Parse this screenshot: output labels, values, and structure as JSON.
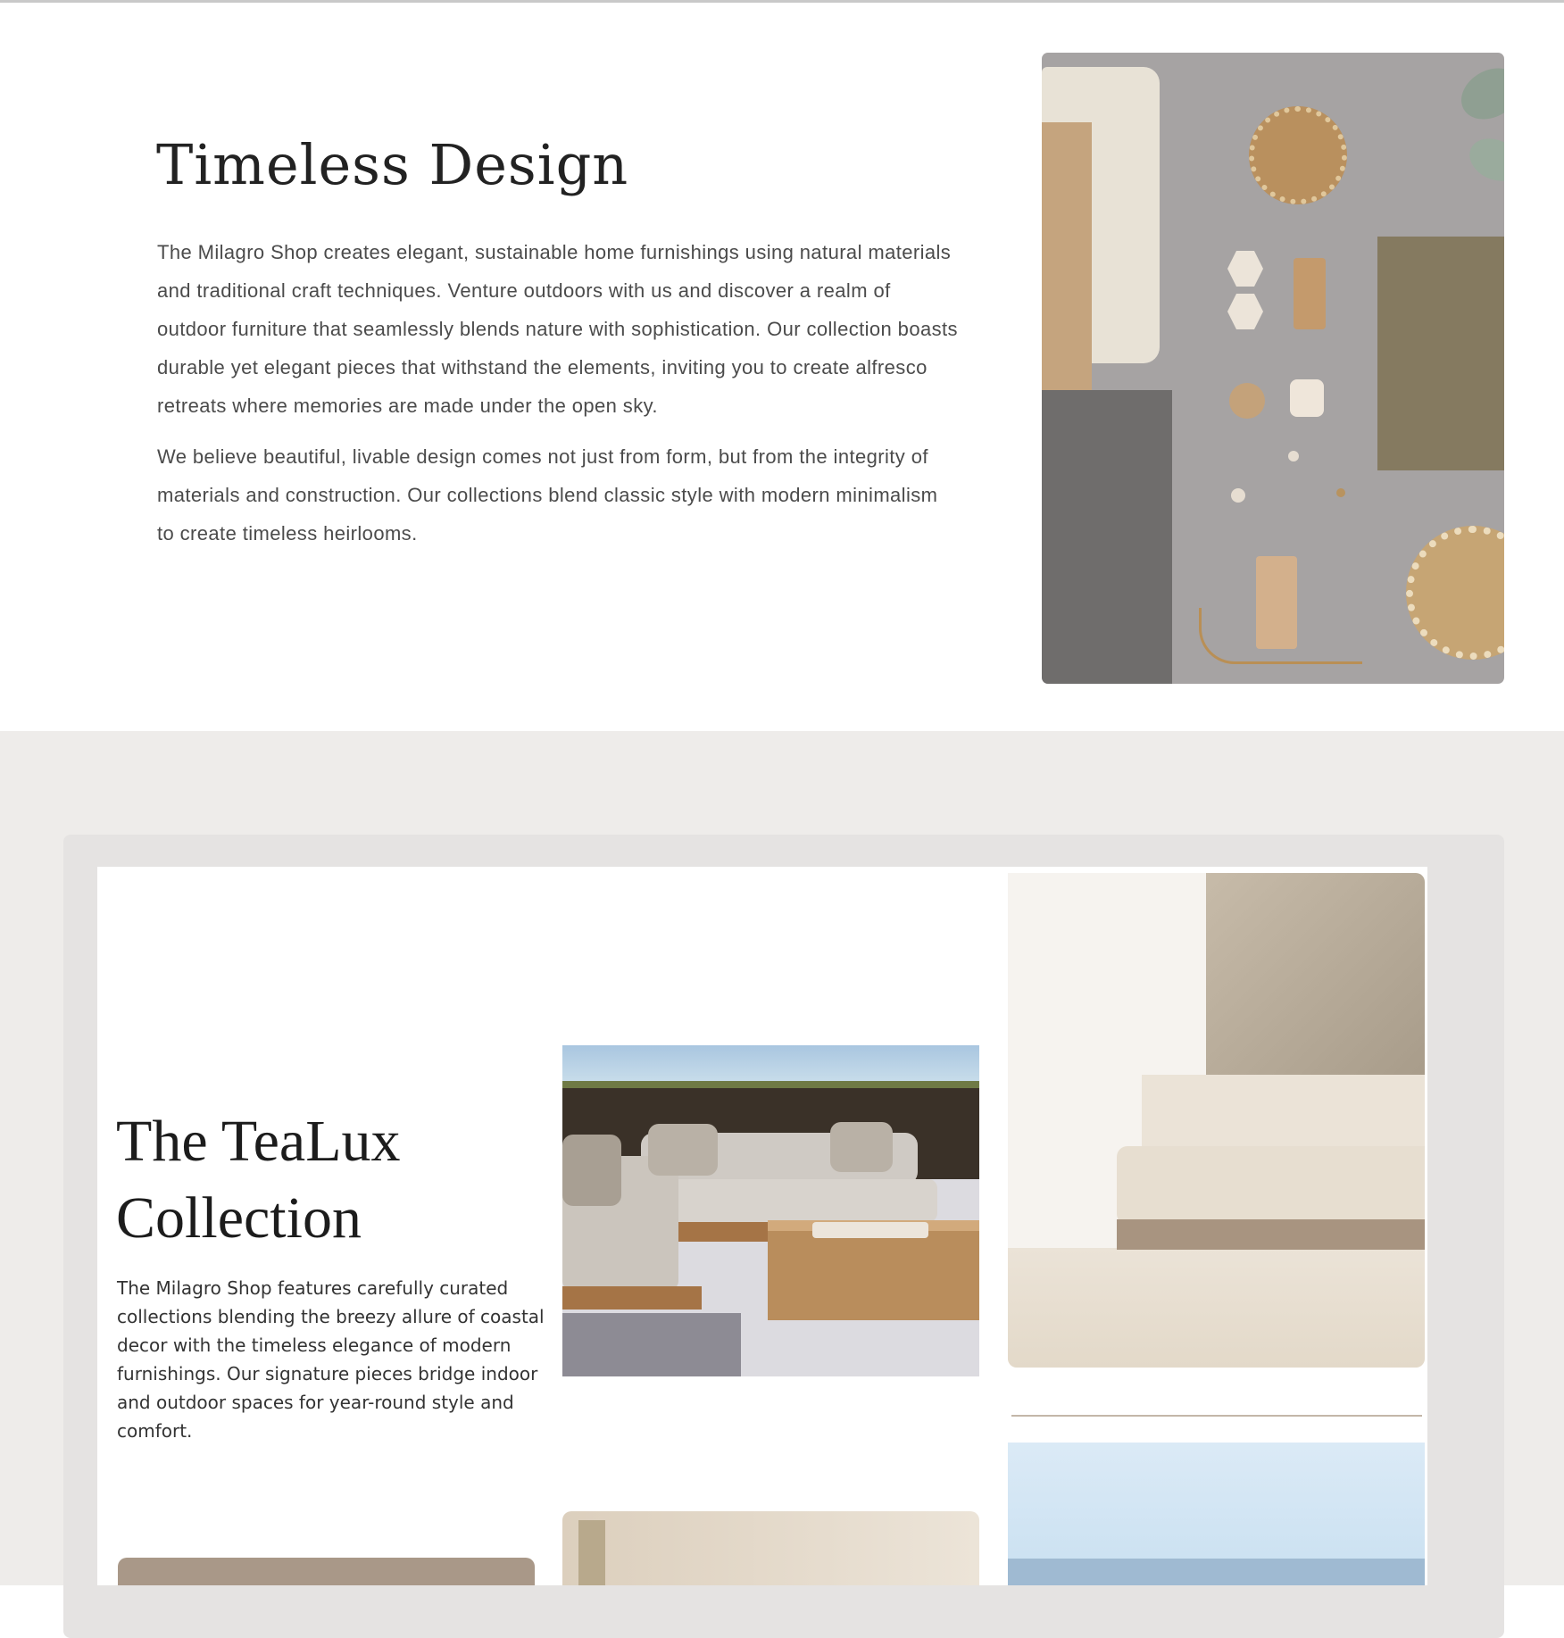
{
  "about": {
    "title": "Timeless Design",
    "paragraphs": [
      "The Milagro Shop creates elegant, sustainable home furnishings using natural materials and traditional craft techniques. Venture outdoors with us and discover a realm of outdoor furniture that seamlessly blends nature with sophistication. Our collection boasts durable yet elegant pieces that withstand the elements, inviting you to create alfresco retreats where memories are made under the open sky.",
      "We believe beautiful, livable design comes not just from form, but from the integrity of materials and construction. Our collections blend classic style with modern minimalism to create timeless heirlooms."
    ]
  },
  "collection": {
    "title": "The TeaLux Collection",
    "description": "The Milagro Shop features carefully curated collections blending the breezy allure of coastal decor with the timeless elegance of modern furnishings. Our signature pieces bridge indoor and outdoor spaces for year-round style and comfort."
  },
  "colors": {
    "page_background": "#ffffff",
    "section_background": "#eeecea",
    "card_background": "#e5e3e2",
    "heading": "#222222",
    "body_text": "#4b4b4b"
  }
}
